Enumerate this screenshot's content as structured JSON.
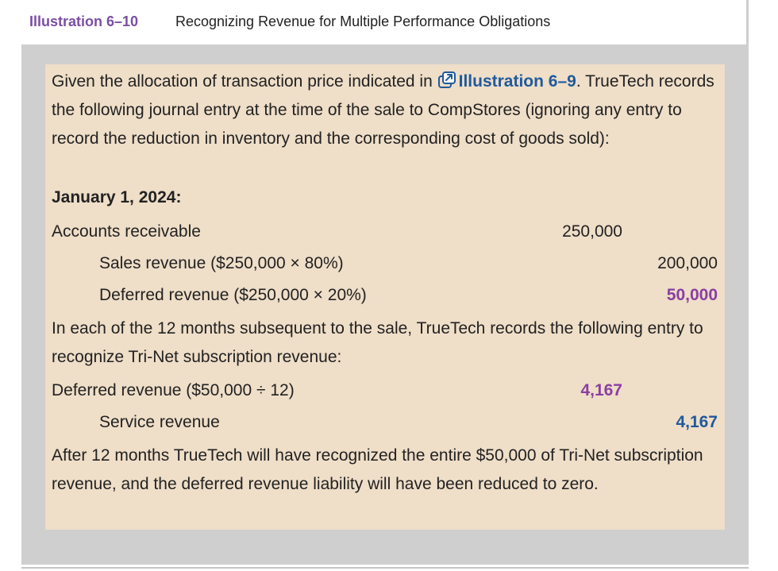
{
  "illustration": {
    "number": "Illustration 6–10",
    "title": "Recognizing Revenue for Multiple Performance Obligations"
  },
  "intro": {
    "before_link": "Given the allocation of transaction price indicated in ",
    "link_label": "Illustration 6–9",
    "after_link": ". TrueTech records the following journal entry at the time of the sale to CompStores (ignoring any entry to record the reduction in inventory and the corresponding cost of goods sold):"
  },
  "entry1": {
    "date": "January 1, 2024:",
    "debit_account": "Accounts receivable",
    "debit_amount": "250,000",
    "credit1_account": "Sales revenue ($250,000 × 80%)",
    "credit1_amount": "200,000",
    "credit2_account": "Deferred revenue ($250,000 × 20%)",
    "credit2_amount": "50,000"
  },
  "middle_text": "In each of the 12 months subsequent to the sale, TrueTech records the following entry to recognize Tri-Net subscription revenue:",
  "entry2": {
    "debit_account": "Deferred revenue ($50,000 ÷ 12)",
    "debit_amount": "4,167",
    "credit_account": "Service revenue",
    "credit_amount": "4,167"
  },
  "closing_text": "After 12 months TrueTech will have recognized the entire $50,000 of Tri-Net subscription revenue, and the deferred revenue liability will have been reduced to zero.",
  "icons": {
    "link_icon": "external-link-icon"
  },
  "colors": {
    "illustration_label": "#7b4ea3",
    "link": "#1f5a9b",
    "highlight_purple": "#8a3fa3",
    "highlight_blue": "#1f5a9b",
    "panel_background": "#efdec8",
    "frame_background": "#cfcfcf"
  }
}
